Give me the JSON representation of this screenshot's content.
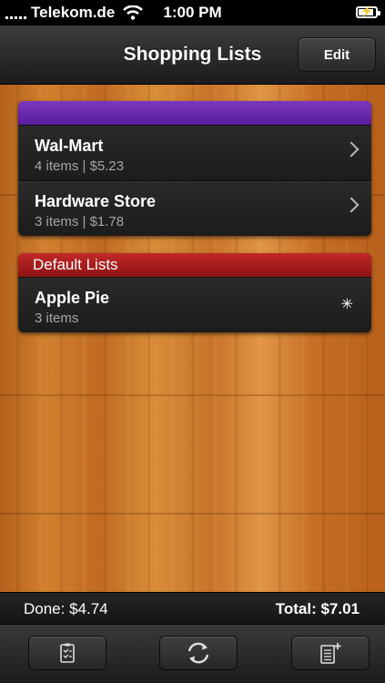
{
  "status_bar": {
    "carrier": "Telekom.de",
    "time": "1:00 PM",
    "battery_icon": "battery-charging-icon",
    "wifi_icon": "wifi-icon"
  },
  "navbar": {
    "title": "Shopping Lists",
    "edit_label": "Edit"
  },
  "groups": [
    {
      "header": "",
      "color": "#6a2bb0",
      "rows": [
        {
          "name": "Wal-Mart",
          "detail": "4 items | $5.23",
          "accessory": "chevron-right-icon"
        },
        {
          "name": "Hardware Store",
          "detail": "3 items | $1.78",
          "accessory": "chevron-right-icon"
        }
      ]
    },
    {
      "header": "Default Lists",
      "color": "#b21e1e",
      "rows": [
        {
          "name": "Apple Pie",
          "detail": "3 items",
          "accessory": "asterisk-icon"
        }
      ]
    }
  ],
  "totals": {
    "done": "Done: $4.74",
    "total": "Total: $7.01"
  },
  "toolbar": {
    "buttons": [
      {
        "icon": "checklist-icon"
      },
      {
        "icon": "sync-icon"
      },
      {
        "icon": "new-list-icon"
      }
    ]
  }
}
